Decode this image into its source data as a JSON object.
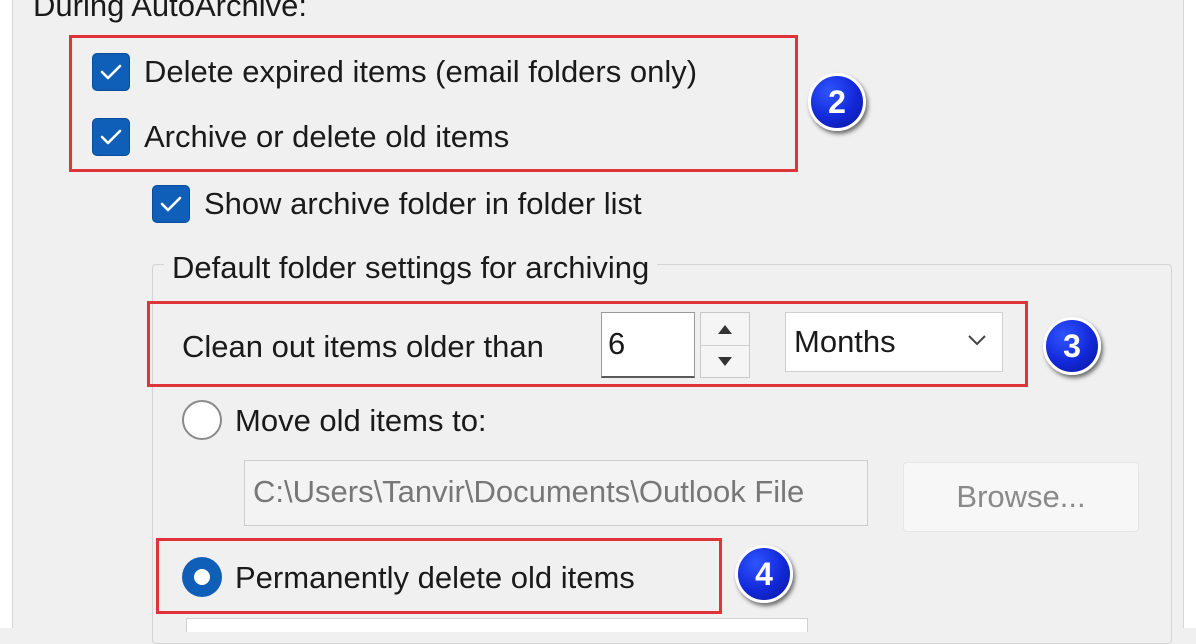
{
  "section_label": "During AutoArchive:",
  "checkboxes": [
    {
      "label": "Delete expired items (email folders only)",
      "checked": true
    },
    {
      "label": "Archive or delete old items",
      "checked": true
    },
    {
      "label": "Show archive folder in folder list",
      "checked": true
    }
  ],
  "default_settings": {
    "group_label": "Default folder settings for archiving",
    "clean_out_label": "Clean out items older than",
    "clean_out_value": "6",
    "unit_selected": "Months",
    "move_option_label": "Move old items to:",
    "move_option_selected": false,
    "move_path": "C:\\Users\\Tanvir\\Documents\\Outlook File",
    "browse_label": "Browse...",
    "delete_option_label": "Permanently delete old items",
    "delete_option_selected": true
  },
  "annotations": {
    "badge_2": "2",
    "badge_3": "3",
    "badge_4": "4",
    "highlight_color": "#e0343a",
    "badge_color": "#1228d8"
  },
  "colors": {
    "checkbox_accent": "#0f5fb8",
    "dialog_background": "#f0f0f0"
  },
  "icons": {
    "checkmark": "check-icon",
    "spin_up": "arrow-up-icon",
    "spin_down": "arrow-down-icon",
    "dropdown": "chevron-down-icon"
  }
}
